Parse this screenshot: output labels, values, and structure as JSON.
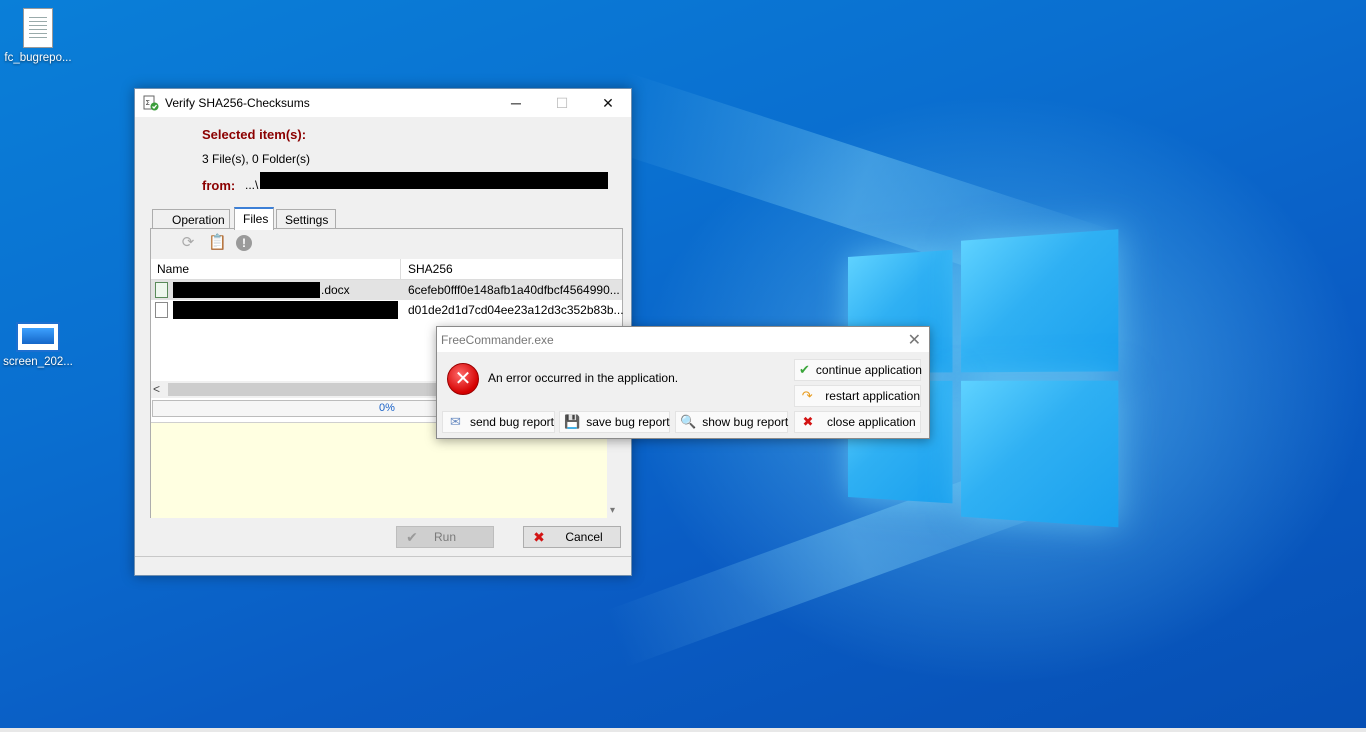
{
  "desktop": {
    "icons": [
      {
        "label": "fc_bugrepo..."
      },
      {
        "label": "screen_202..."
      }
    ]
  },
  "window": {
    "title": "Verify SHA256-Checksums",
    "caption": {
      "minimize": "─",
      "maximize": "☐",
      "close": "✕"
    },
    "selected_label": "Selected item(s):",
    "count_text": "3 File(s), 0 Folder(s)",
    "from_label": "from:",
    "from_path": "...\\",
    "tabs": [
      "Operation",
      "Files",
      "Settings"
    ],
    "active_tab": "Files",
    "toolbar_icons": [
      "refresh-icon",
      "clipboard-icon",
      "warning-icon"
    ],
    "columns": {
      "name": "Name",
      "hash": "SHA256"
    },
    "rows": [
      {
        "name_suffix": ".docx",
        "hash": "6cefeb0fff0e148afb1a40dfbcf4564990...",
        "selected": true
      },
      {
        "name_suffix": "",
        "hash": "d01de2d1d7cd04ee23a12d3c352b83b...",
        "selected": false
      }
    ],
    "progress": {
      "text": "0%",
      "value": 0
    },
    "buttons": {
      "run": "Run",
      "cancel": "Cancel"
    }
  },
  "error_dialog": {
    "title": "FreeCommander.exe",
    "message": "An error occurred in the application.",
    "buttons": {
      "continue": "continue application",
      "restart": "restart application",
      "send": "send bug report",
      "save": "save bug report",
      "show": "show bug report",
      "close": "close application"
    }
  },
  "colors": {
    "accent_red_label": "#8b0000",
    "desktop_blue": "#0a6fd0",
    "progress_text": "#1a62c8",
    "log_background": "#ffffe1"
  }
}
